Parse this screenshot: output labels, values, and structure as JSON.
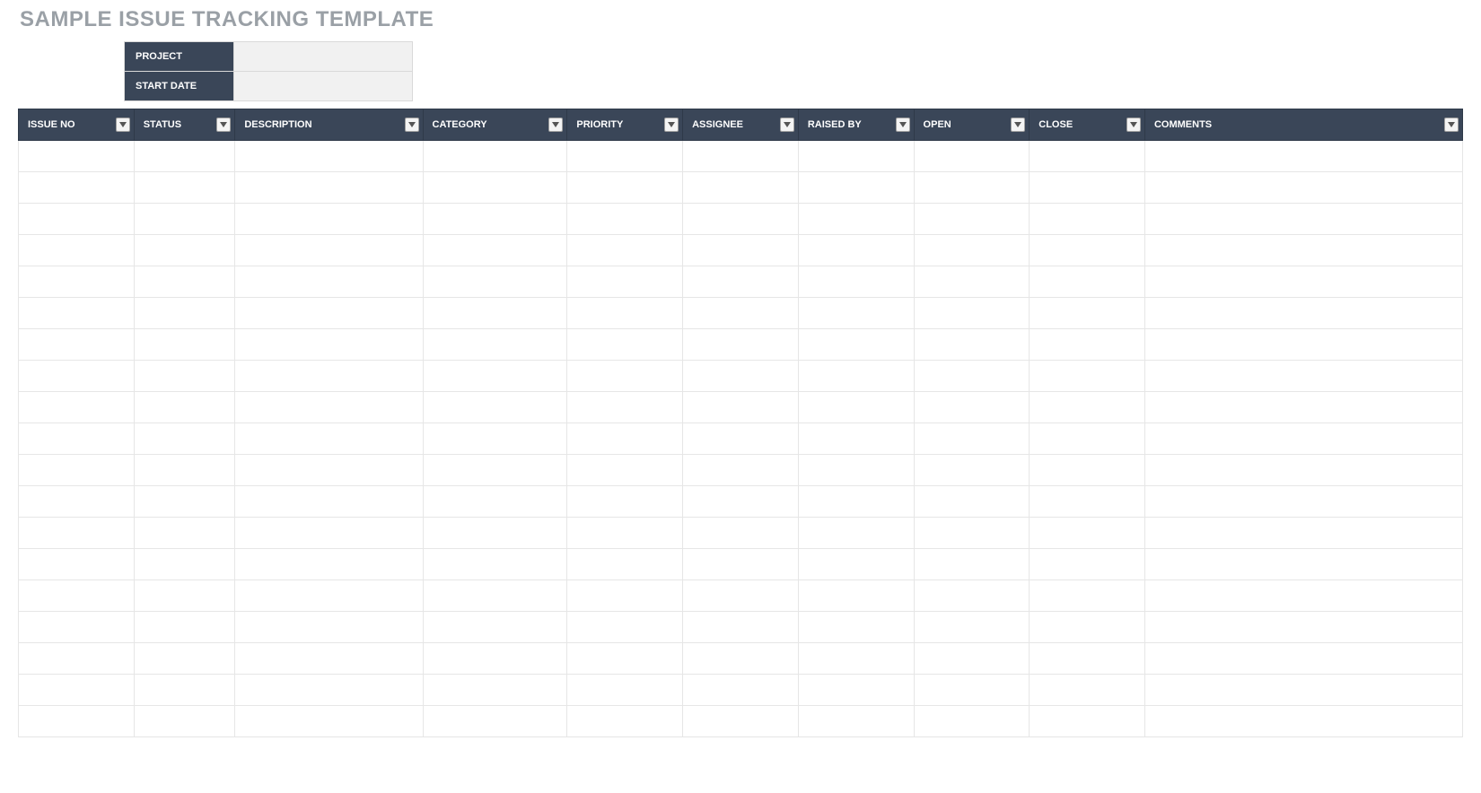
{
  "title": "SAMPLE ISSUE TRACKING TEMPLATE",
  "meta": {
    "project_label": "PROJECT",
    "project_value": "",
    "start_date_label": "START DATE",
    "start_date_value": ""
  },
  "columns": [
    {
      "key": "issue_no",
      "label": "ISSUE NO"
    },
    {
      "key": "status",
      "label": "STATUS"
    },
    {
      "key": "description",
      "label": "DESCRIPTION"
    },
    {
      "key": "category",
      "label": "CATEGORY"
    },
    {
      "key": "priority",
      "label": "PRIORITY"
    },
    {
      "key": "assignee",
      "label": "ASSIGNEE"
    },
    {
      "key": "raised_by",
      "label": "RAISED BY"
    },
    {
      "key": "open",
      "label": "OPEN"
    },
    {
      "key": "close",
      "label": "CLOSE"
    },
    {
      "key": "comments",
      "label": "COMMENTS"
    }
  ],
  "rows": [
    {
      "issue_no": "",
      "status": "",
      "description": "",
      "category": "",
      "priority": "",
      "assignee": "",
      "raised_by": "",
      "open": "",
      "close": "",
      "comments": ""
    },
    {
      "issue_no": "",
      "status": "",
      "description": "",
      "category": "",
      "priority": "",
      "assignee": "",
      "raised_by": "",
      "open": "",
      "close": "",
      "comments": ""
    },
    {
      "issue_no": "",
      "status": "",
      "description": "",
      "category": "",
      "priority": "",
      "assignee": "",
      "raised_by": "",
      "open": "",
      "close": "",
      "comments": ""
    },
    {
      "issue_no": "",
      "status": "",
      "description": "",
      "category": "",
      "priority": "",
      "assignee": "",
      "raised_by": "",
      "open": "",
      "close": "",
      "comments": ""
    },
    {
      "issue_no": "",
      "status": "",
      "description": "",
      "category": "",
      "priority": "",
      "assignee": "",
      "raised_by": "",
      "open": "",
      "close": "",
      "comments": ""
    },
    {
      "issue_no": "",
      "status": "",
      "description": "",
      "category": "",
      "priority": "",
      "assignee": "",
      "raised_by": "",
      "open": "",
      "close": "",
      "comments": ""
    },
    {
      "issue_no": "",
      "status": "",
      "description": "",
      "category": "",
      "priority": "",
      "assignee": "",
      "raised_by": "",
      "open": "",
      "close": "",
      "comments": ""
    },
    {
      "issue_no": "",
      "status": "",
      "description": "",
      "category": "",
      "priority": "",
      "assignee": "",
      "raised_by": "",
      "open": "",
      "close": "",
      "comments": ""
    },
    {
      "issue_no": "",
      "status": "",
      "description": "",
      "category": "",
      "priority": "",
      "assignee": "",
      "raised_by": "",
      "open": "",
      "close": "",
      "comments": ""
    },
    {
      "issue_no": "",
      "status": "",
      "description": "",
      "category": "",
      "priority": "",
      "assignee": "",
      "raised_by": "",
      "open": "",
      "close": "",
      "comments": ""
    },
    {
      "issue_no": "",
      "status": "",
      "description": "",
      "category": "",
      "priority": "",
      "assignee": "",
      "raised_by": "",
      "open": "",
      "close": "",
      "comments": ""
    },
    {
      "issue_no": "",
      "status": "",
      "description": "",
      "category": "",
      "priority": "",
      "assignee": "",
      "raised_by": "",
      "open": "",
      "close": "",
      "comments": ""
    },
    {
      "issue_no": "",
      "status": "",
      "description": "",
      "category": "",
      "priority": "",
      "assignee": "",
      "raised_by": "",
      "open": "",
      "close": "",
      "comments": ""
    },
    {
      "issue_no": "",
      "status": "",
      "description": "",
      "category": "",
      "priority": "",
      "assignee": "",
      "raised_by": "",
      "open": "",
      "close": "",
      "comments": ""
    },
    {
      "issue_no": "",
      "status": "",
      "description": "",
      "category": "",
      "priority": "",
      "assignee": "",
      "raised_by": "",
      "open": "",
      "close": "",
      "comments": ""
    },
    {
      "issue_no": "",
      "status": "",
      "description": "",
      "category": "",
      "priority": "",
      "assignee": "",
      "raised_by": "",
      "open": "",
      "close": "",
      "comments": ""
    },
    {
      "issue_no": "",
      "status": "",
      "description": "",
      "category": "",
      "priority": "",
      "assignee": "",
      "raised_by": "",
      "open": "",
      "close": "",
      "comments": ""
    },
    {
      "issue_no": "",
      "status": "",
      "description": "",
      "category": "",
      "priority": "",
      "assignee": "",
      "raised_by": "",
      "open": "",
      "close": "",
      "comments": ""
    },
    {
      "issue_no": "",
      "status": "",
      "description": "",
      "category": "",
      "priority": "",
      "assignee": "",
      "raised_by": "",
      "open": "",
      "close": "",
      "comments": ""
    }
  ]
}
